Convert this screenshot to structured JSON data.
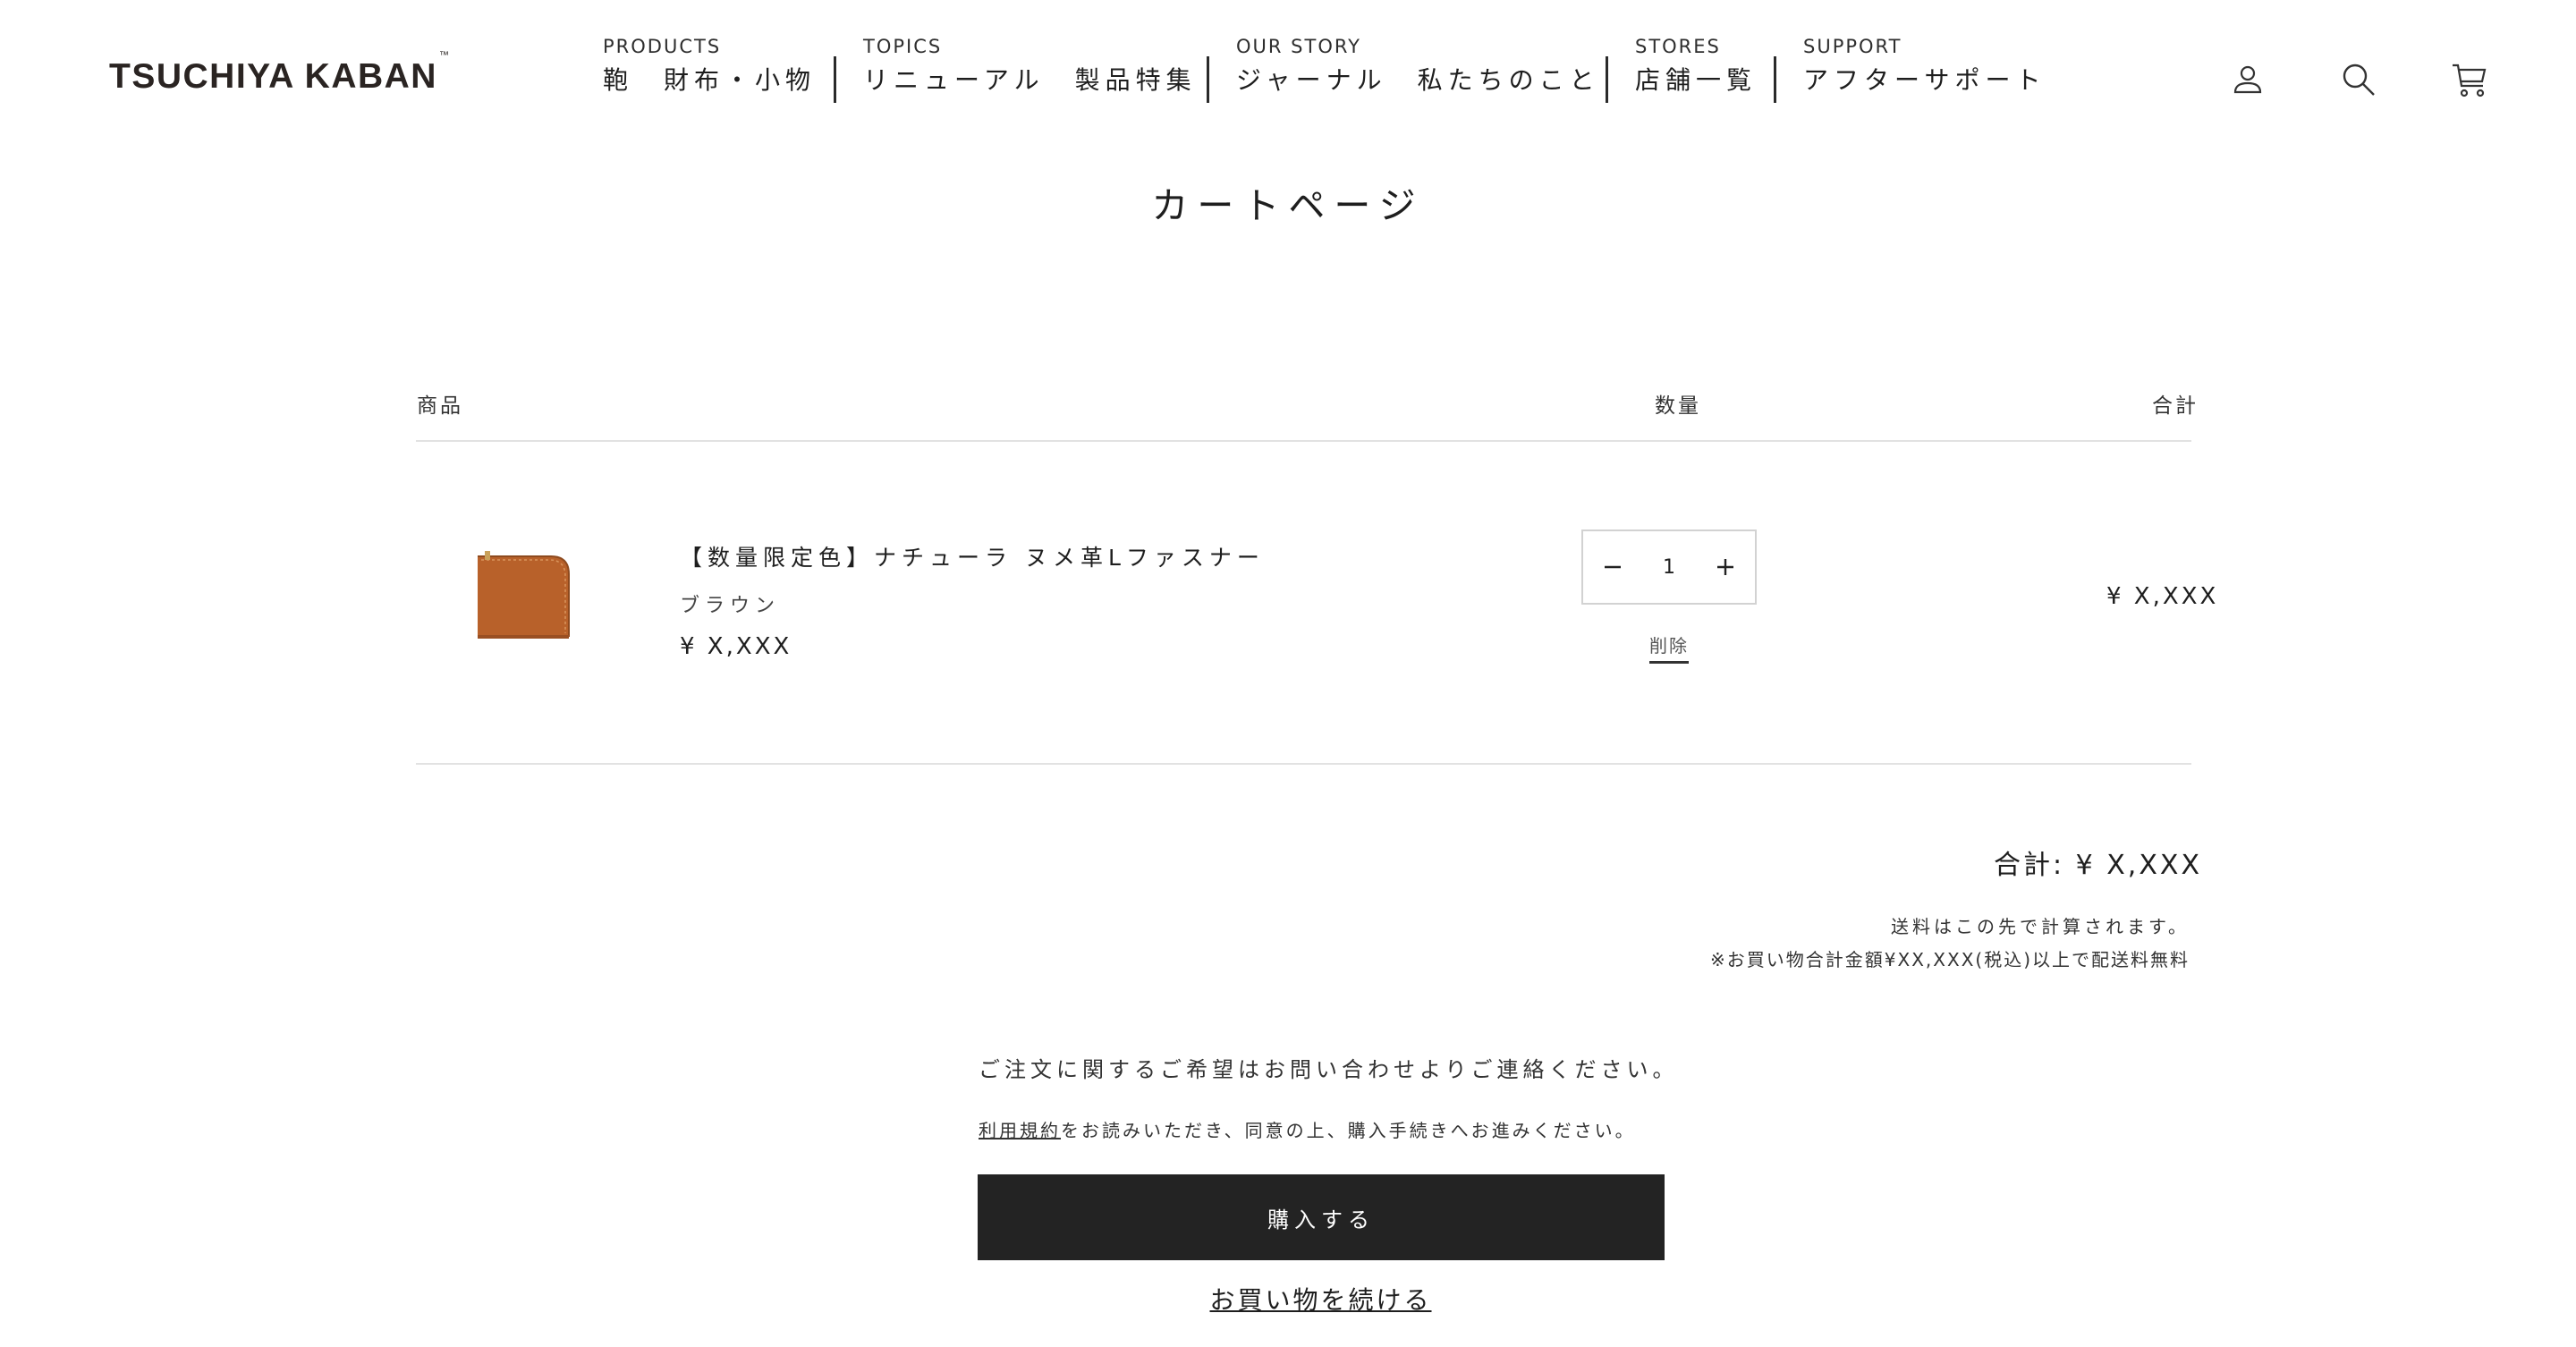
{
  "header": {
    "logo": "TSUCHIYA KABAN",
    "logo_tm": "™",
    "nav": [
      {
        "category": "PRODUCTS",
        "items": [
          "鞄",
          "財布・小物"
        ]
      },
      {
        "category": "TOPICS",
        "items": [
          "リニューアル",
          "製品特集"
        ]
      },
      {
        "category": "OUR STORY",
        "items": [
          "ジャーナル",
          "私たちのこと"
        ]
      },
      {
        "category": "STORES",
        "items": [
          "店舗一覧"
        ]
      },
      {
        "category": "SUPPORT",
        "items": [
          "アフターサポート"
        ]
      }
    ],
    "icons": [
      "account-icon",
      "search-icon",
      "cart-icon"
    ]
  },
  "page": {
    "title": "カートページ"
  },
  "cart": {
    "headers": {
      "product": "商品",
      "quantity": "数量",
      "total": "合計"
    },
    "items": [
      {
        "name": "【数量限定色】ナチューラ ヌメ革Lファスナー",
        "variant": "ブラウン",
        "price": "¥ X,XXX",
        "quantity": "1",
        "remove_label": "削除",
        "line_total": "¥ X,XXX",
        "image_color": "#b8612a"
      }
    ]
  },
  "summary": {
    "total": "合計: ¥ X,XXX",
    "shipping_note": "送料はこの先で計算されます。",
    "free_shipping_note": "※お買い物合計金額¥XX,XXX(税込)以上で配送料無料",
    "contact_note": "ご注文に関するご希望はお問い合わせよりご連絡ください。",
    "terms_link": "利用規約",
    "terms_text": "をお読みいただき、同意の上、購入手続きへお進みください。",
    "checkout_button": "購入する",
    "continue_link": "お買い物を続ける"
  },
  "colors": {
    "accent": "#232323",
    "text": "#222222",
    "divider": "#e2e2e2",
    "product": "#b8612a"
  }
}
